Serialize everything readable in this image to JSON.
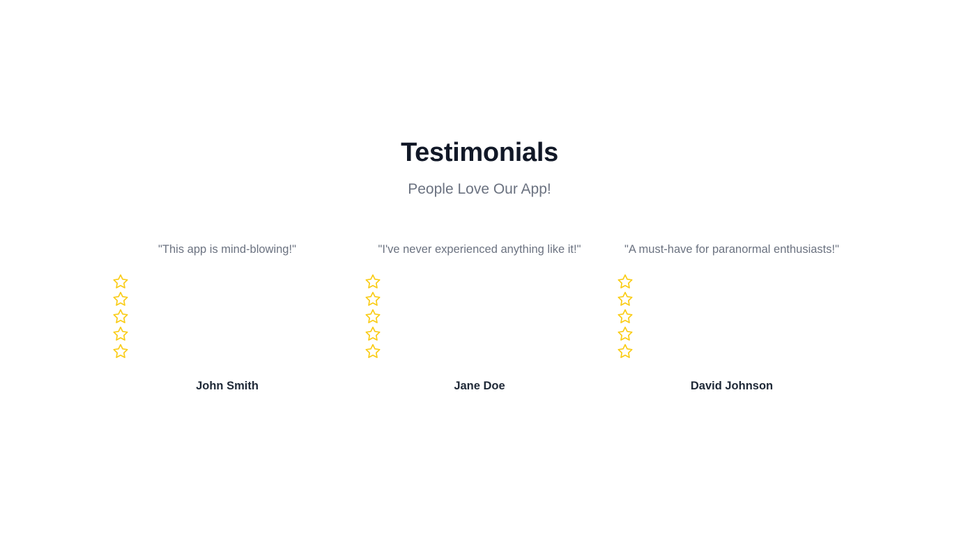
{
  "section": {
    "title": "Testimonials",
    "subtitle": "People Love Our App!"
  },
  "colors": {
    "star": "#facc15",
    "title": "#111827",
    "muted": "#6b7280",
    "author": "#1f2937"
  },
  "testimonials": [
    {
      "quote": "\"This app is mind-blowing!\"",
      "author": "John Smith",
      "rating": 5,
      "star_icon": "star-outline-icon"
    },
    {
      "quote": "\"I've never experienced anything like it!\"",
      "author": "Jane Doe",
      "rating": 5,
      "star_icon": "star-outline-icon"
    },
    {
      "quote": "\"A must-have for paranormal enthusiasts!\"",
      "author": "David Johnson",
      "rating": 5,
      "star_icon": "star-outline-icon"
    }
  ]
}
